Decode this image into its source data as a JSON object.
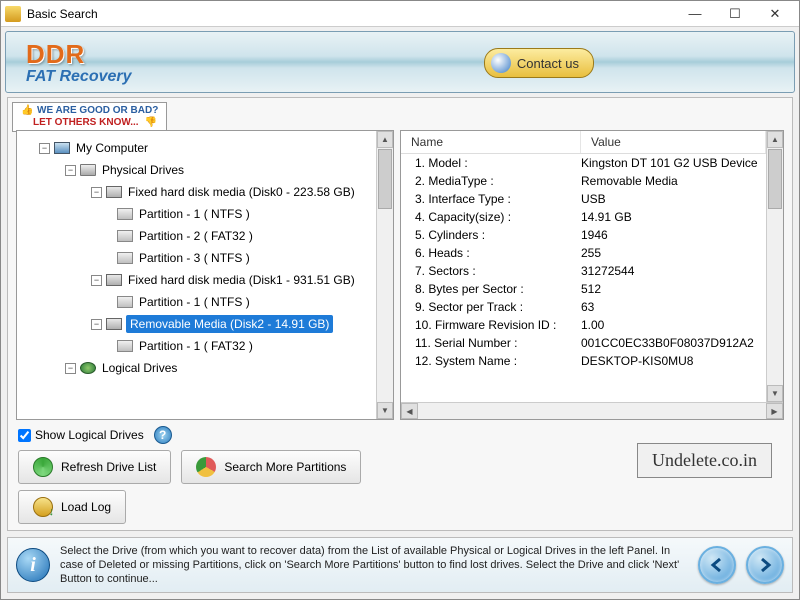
{
  "window": {
    "title": "Basic Search"
  },
  "header": {
    "logo": "DDR",
    "subtitle": "FAT Recovery",
    "contact": "Contact us"
  },
  "review": {
    "line1": "WE ARE GOOD OR BAD?",
    "line2": "LET OTHERS KNOW..."
  },
  "tree": {
    "root": "My Computer",
    "physical": "Physical Drives",
    "disk0": "Fixed hard disk media (Disk0 - 223.58 GB)",
    "disk0_p1": "Partition - 1 ( NTFS )",
    "disk0_p2": "Partition - 2 ( FAT32 )",
    "disk0_p3": "Partition - 3 ( NTFS )",
    "disk1": "Fixed hard disk media (Disk1 - 931.51 GB)",
    "disk1_p1": "Partition - 1 ( NTFS )",
    "disk2": "Removable Media (Disk2 - 14.91 GB)",
    "disk2_p1": "Partition - 1 ( FAT32 )",
    "logical": "Logical Drives"
  },
  "table": {
    "col_name": "Name",
    "col_value": "Value",
    "rows": [
      {
        "n": "1. Model :",
        "v": "Kingston DT 101 G2 USB Device"
      },
      {
        "n": "2. MediaType :",
        "v": "Removable Media"
      },
      {
        "n": "3. Interface Type :",
        "v": "USB"
      },
      {
        "n": "4. Capacity(size) :",
        "v": "14.91 GB"
      },
      {
        "n": "5. Cylinders :",
        "v": "1946"
      },
      {
        "n": "6. Heads :",
        "v": "255"
      },
      {
        "n": "7. Sectors :",
        "v": "31272544"
      },
      {
        "n": "8. Bytes per Sector :",
        "v": "512"
      },
      {
        "n": "9. Sector per Track :",
        "v": "63"
      },
      {
        "n": "10. Firmware Revision ID :",
        "v": "1.00"
      },
      {
        "n": "11. Serial Number :",
        "v": "001CC0EC33B0F08037D912A2"
      },
      {
        "n": "12. System Name :",
        "v": "DESKTOP-KIS0MU8"
      }
    ]
  },
  "controls": {
    "show_logical": "Show Logical Drives",
    "refresh": "Refresh Drive List",
    "search_more": "Search More Partitions",
    "load_log": "Load Log"
  },
  "watermark": "Undelete.co.in",
  "footer": {
    "text": "Select the Drive (from which you want to recover data) from the List of available Physical or Logical Drives in the left Panel. In case of Deleted or missing Partitions, click on 'Search More Partitions' button to find lost drives. Select the Drive and click 'Next' Button to continue..."
  }
}
